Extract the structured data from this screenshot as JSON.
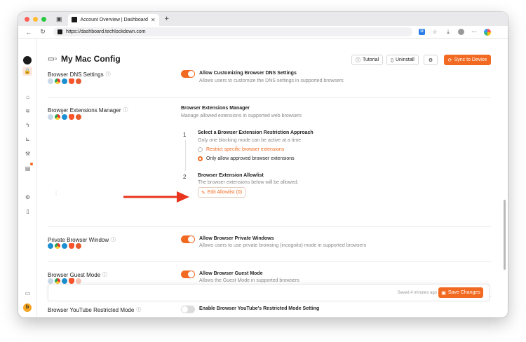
{
  "browser": {
    "tab_title": "Account Overview | Dashboard",
    "tab_close": "✕",
    "new_tab": "+",
    "url": "https://dashboard.techlockdown.com",
    "ext_label": "U"
  },
  "sidebar": {
    "user_initial": "b"
  },
  "header": {
    "title": "My Mac Config",
    "tutorial_label": "Tutorial",
    "uninstall_label": "Uninstall",
    "sync_label": "Sync to Device"
  },
  "settings": {
    "dns": {
      "title": "Browser DNS Settings",
      "option_title": "Allow Customizing Browser DNS Settings",
      "option_desc": "Allows users to customize the DNS settings in supported browsers"
    },
    "extensions": {
      "title": "Browser Extensions Manager",
      "option_title": "Browser Extensions Manager",
      "option_desc": "Manage allowed extensions in supported web browsers",
      "step1": {
        "number": "1",
        "title": "Select a Browser Extension Restriction Approach",
        "desc": "Only one blocking mode can be active at a time",
        "option_a": "Restrict specific browser extensions",
        "option_b": "Only allow approved browser extensions",
        "selected": "option_b"
      },
      "step2": {
        "number": "2",
        "title": "Browser Extension Allowlist",
        "desc": "The browser extensions below will be allowed.",
        "edit_label": "Edit Allowlist (0)"
      }
    },
    "private": {
      "title": "Private Browser Window",
      "option_title": "Allow Browser Private Windows",
      "option_desc": "Allows users to use private browsing (incognito) mode in supported browsers"
    },
    "guest": {
      "title": "Browser Guest Mode",
      "option_title": "Allow Browser Guest Mode",
      "option_desc": "Allows the Guest Mode in supported browsers"
    },
    "youtube": {
      "title": "Browser YouTube Restricted Mode",
      "option_title": "Enable Browser YouTube's Restricted Mode Setting"
    }
  },
  "footer": {
    "saved_text": "Saved 4 minutes ago",
    "save_label": "Save Changes"
  },
  "colors": {
    "accent": "#f26a21",
    "arrow": "#e8341c"
  }
}
